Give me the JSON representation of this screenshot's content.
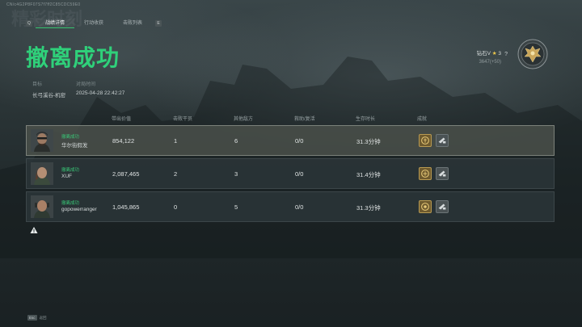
{
  "session_id": "CN/c4G2P8F07S7f7ff2C85CDC59E0",
  "watermark": "精彩时刻",
  "tabs": {
    "left_key": "Q",
    "right_key": "E",
    "items": [
      {
        "label": "战绩详情",
        "active": true
      },
      {
        "label": "行动收获",
        "active": false
      },
      {
        "label": "击败列表",
        "active": false
      }
    ]
  },
  "title": "撤离成功",
  "meta": {
    "target_label": "目标",
    "target_value": "长弓溪谷-机密",
    "time_label": "对局时间",
    "time_value": "2025-04-28 22:42:27"
  },
  "rank": {
    "tier": "钻石V",
    "stars": "3",
    "points": "3647(+50)",
    "help": "?"
  },
  "columns": [
    "带出价值",
    "击败干员",
    "其他敌方",
    "救助/复活",
    "生存时长",
    "成就"
  ],
  "players": [
    {
      "status": "撤离成功",
      "name": "华尔街假发",
      "value": "854,122",
      "kills": "1",
      "other": "6",
      "revive": "0/0",
      "survival": "31.3分钟",
      "highlight": true
    },
    {
      "status": "撤离成功",
      "name": "XUF",
      "value": "2,087,465",
      "kills": "2",
      "other": "3",
      "revive": "0/0",
      "survival": "31.4分钟",
      "highlight": false
    },
    {
      "status": "撤离成功",
      "name": "gopowerranger",
      "value": "1,045,865",
      "kills": "0",
      "other": "5",
      "revive": "0/0",
      "survival": "31.3分钟",
      "highlight": false
    }
  ],
  "footer": {
    "key": "Esc",
    "label": "返回"
  },
  "icons": {
    "achievement_1": "gold-medal-icon",
    "achievement_2": "weapon-icon",
    "rank_badge": "eagle-emblem-icon",
    "warning": "warning-icon"
  },
  "colors": {
    "accent": "#2fd07a",
    "star": "#f0c94a"
  }
}
